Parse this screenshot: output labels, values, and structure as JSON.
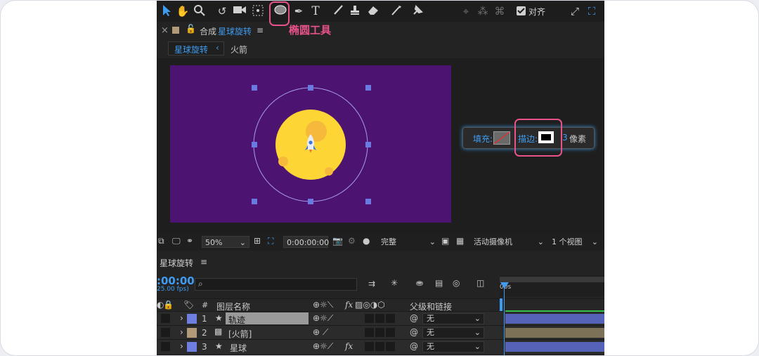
{
  "toolbar": {
    "align_label": "对齐"
  },
  "callout_label": "椭圆工具",
  "panel": {
    "close": "×",
    "comp_prefix": "合成",
    "comp_name": "星球旋转",
    "menu": "≡",
    "tabs": [
      "星球旋转",
      "火箭"
    ]
  },
  "shape_options": {
    "fill_label": "填充:",
    "stroke_label": "描边:",
    "stroke_width": "3",
    "unit": "像素"
  },
  "viewer_bar": {
    "zoom": "50%",
    "timecode": "0:00:00:00",
    "resolution": "完整",
    "camera": "活动摄像机",
    "views": "1 个视图"
  },
  "timeline": {
    "title": "星球旋转",
    "current_time": ":00:00",
    "fps": "25.00 fps)",
    "ruler_label": "00s",
    "col_hash": "#",
    "col_layer_name": "图层名称",
    "col_fx": "fx",
    "col_parent": "父级和链接",
    "layers": [
      {
        "num": "1",
        "name": "轨迹",
        "parent": "无",
        "color": "#6f7fe0",
        "bar_color": "#5462b8"
      },
      {
        "num": "2",
        "name": "[火箭]",
        "parent": "无",
        "color": "#b09a78",
        "bar_color": "#7d7158"
      },
      {
        "num": "3",
        "name": "星球",
        "parent": "无",
        "color": "#6f7fe0",
        "bar_color": "#5462b8"
      }
    ]
  },
  "colors": {
    "accent": "#3f9cf0",
    "highlight": "#e8528a",
    "comp_bg": "#4c1470",
    "planet": "#fdd535"
  }
}
